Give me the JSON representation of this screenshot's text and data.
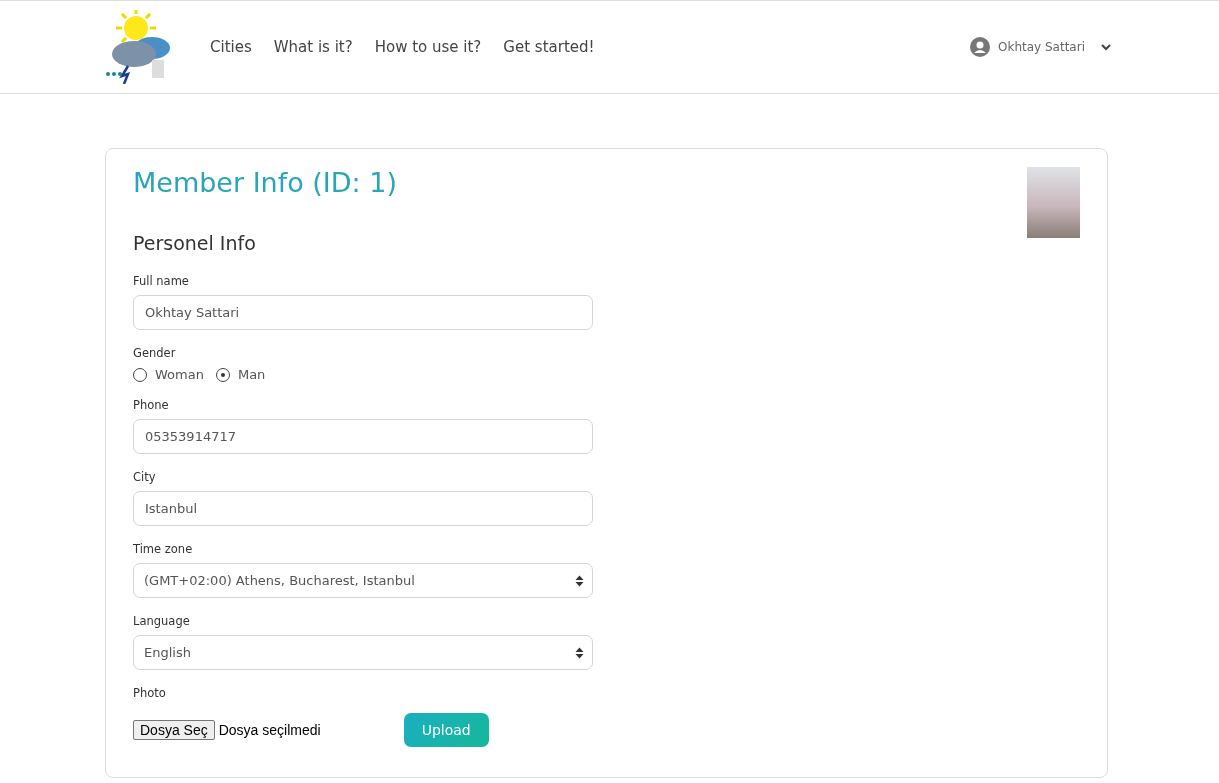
{
  "nav": {
    "links": [
      "Cities",
      "What is it?",
      "How to use it?",
      "Get started!"
    ],
    "user": "Okhtay Sattari"
  },
  "card": {
    "title": "Member Info (ID: 1)",
    "section": "Personel Info",
    "fields": [
      {
        "kind": "text",
        "label": "Full name",
        "value": "Okhtay Sattari"
      },
      {
        "kind": "radio",
        "label": "Gender",
        "options": [
          {
            "label": "Woman",
            "selected": false
          },
          {
            "label": "Man",
            "selected": true
          }
        ]
      },
      {
        "kind": "text",
        "label": "Phone",
        "value": "05353914717"
      },
      {
        "kind": "text",
        "label": "City",
        "value": "Istanbul"
      },
      {
        "kind": "select",
        "label": "Time zone",
        "value": "(GMT+02:00) Athens, Bucharest, Istanbul"
      },
      {
        "kind": "select",
        "label": "Language",
        "value": "English"
      },
      {
        "kind": "file",
        "label": "Photo",
        "choose": "Dosya Seç",
        "status": "Dosya seçilmedi",
        "button": "Upload"
      }
    ]
  }
}
